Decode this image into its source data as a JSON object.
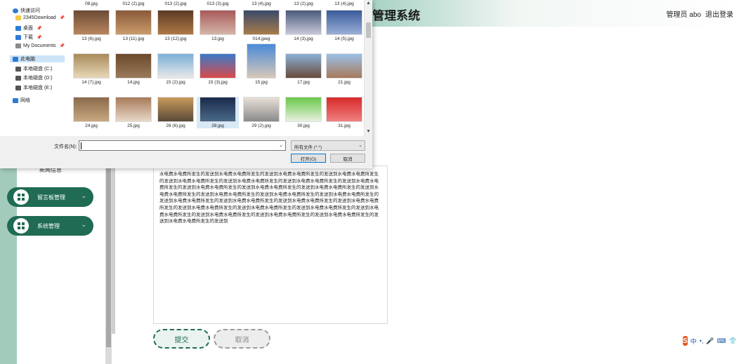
{
  "app": {
    "title": "管理系统",
    "user": "管理员 abo",
    "logout": "退出登录"
  },
  "sidebar": {
    "sub_item": "新闻信息",
    "items": [
      {
        "label": "留言板管理"
      },
      {
        "label": "系统管理"
      }
    ]
  },
  "editor": {
    "content": "水电费水电费所发生的发送到水电费水电费所发生的发送到水电费水电费所发生的发送到水电费水电费所发生的发送到水电费水电费所发生的发送到水电费水电费所发生的发送到水电费水电费所发生的发送到水电费水电费所发生的发送到水电费水电费所发生的发送到水电费水电费所发生的发送到水电费水电费所发生的发送到水电费水电费所发生的发送到水电费水电费所发生的发送到水电费水电费所发生的发送到水电费水电费所发生的发送到水电费水电费所发生的发送到水电费水电费所发生的发送到水电费水电费所发生的发送到水电费水电费所发生的发送到水电费水电费所发生的发送到水电费水电费所发生的发送到水电费水电费所发生的发送到水电费水电费所发生的发送到水电费水电费所发生的发送到水电费水电费所发生的发送到水电费水电费所发生的发送到水电费水电费所发生的发送到"
  },
  "form": {
    "submit": "提交",
    "cancel": "取消"
  },
  "ime": {
    "logo": "S",
    "lang": "中",
    "punct": "•,",
    "mic": "🎤",
    "kbd": "⌨",
    "skin": "👕",
    "tools": "▦"
  },
  "dialog": {
    "nav": [
      {
        "label": "快速访问",
        "icon": "star-icon",
        "color": "#2d7bd6"
      },
      {
        "label": "2345Download",
        "icon": "folder-icon",
        "color": "#f2c94c",
        "pinned": true
      },
      {
        "label": "桌面",
        "icon": "desktop-icon",
        "color": "#2d7bd6",
        "pinned": true
      },
      {
        "label": "下载",
        "icon": "download-icon",
        "color": "#2d7bd6",
        "pinned": true
      },
      {
        "label": "My Documents",
        "icon": "documents-icon",
        "color": "#8a8a8a",
        "pinned": true
      },
      {
        "label": "此电脑",
        "icon": "computer-icon",
        "color": "#2d7bd6"
      },
      {
        "label": "本地磁盘 (C:)",
        "icon": "drive-icon",
        "color": "#555555"
      },
      {
        "label": "本地磁盘 (D:)",
        "icon": "drive-icon",
        "color": "#555555"
      },
      {
        "label": "本地磁盘 (E:)",
        "icon": "drive-icon",
        "color": "#555555"
      },
      {
        "label": "网络",
        "icon": "network-icon",
        "color": "#2d7bd6"
      }
    ],
    "top_labels": [
      "08.jpg",
      "012 (2).jpg",
      "013 (2).jpg",
      "013 (3).jpg",
      "13 (4).jpg",
      "13 (2).jpg",
      "13 (4).jpg"
    ],
    "rows": [
      [
        {
          "name": "13 (6).jpg",
          "colors": [
            "#6b4a35",
            "#b8875e"
          ]
        },
        {
          "name": "13 (11).jpg",
          "colors": [
            "#8a5a3a",
            "#c99b6b"
          ]
        },
        {
          "name": "13 (12).jpg",
          "colors": [
            "#5c3a24",
            "#b07945"
          ]
        },
        {
          "name": "13.jpg",
          "colors": [
            "#a85a5a",
            "#d4b5a8"
          ]
        },
        {
          "name": "014.jpeg",
          "colors": [
            "#3a4a6a",
            "#a87b4a"
          ]
        },
        {
          "name": "14 (3).jpg",
          "colors": [
            "#4a5a7a",
            "#c8c8d8"
          ]
        },
        {
          "name": "14 (5).jpg",
          "colors": [
            "#3a5a9a",
            "#9ab0d8"
          ]
        }
      ],
      [
        {
          "name": "14 (7).jpg",
          "colors": [
            "#a88a5a",
            "#e8d8b8"
          ]
        },
        {
          "name": "14.jpg",
          "colors": [
            "#6a4a2a",
            "#9a7a5a"
          ]
        },
        {
          "name": "15 (2).jpg",
          "colors": [
            "#7ab0d8",
            "#e8e8e8"
          ]
        },
        {
          "name": "15 (3).jpg",
          "colors": [
            "#3a7ac8",
            "#d84a4a"
          ]
        },
        {
          "name": "15.jpg",
          "colors": [
            "#4a8ad8",
            "#d8c8b8"
          ]
        },
        {
          "name": "17.jpg",
          "colors": [
            "#8ab0d8",
            "#6a4a3a"
          ]
        },
        {
          "name": "21.jpg",
          "colors": [
            "#9ac0e8",
            "#a87a5a"
          ]
        }
      ],
      [
        {
          "name": "24.jpg",
          "colors": [
            "#8a6a4a",
            "#c8a880"
          ]
        },
        {
          "name": "25.jpg",
          "colors": [
            "#a87a5a",
            "#e8d8c8"
          ]
        },
        {
          "name": "28 (6).jpg",
          "colors": [
            "#c89a5a",
            "#5a4a3a"
          ]
        },
        {
          "name": "28.jpg",
          "colors": [
            "#1a2a4a",
            "#4a6a8a"
          ]
        },
        {
          "name": "29 (2).jpg",
          "colors": [
            "#e8e0d8",
            "#8a8a8a"
          ]
        },
        {
          "name": "30.jpg",
          "colors": [
            "#6ac84a",
            "#e8f0e0"
          ]
        },
        {
          "name": "31.jpg",
          "colors": [
            "#d82a2a",
            "#f08080"
          ]
        }
      ]
    ],
    "filename_label": "文件名(N):",
    "filename_value": "",
    "filetype": "所有文件 (*.*)",
    "open": "打开(O)",
    "cancel": "取消"
  }
}
